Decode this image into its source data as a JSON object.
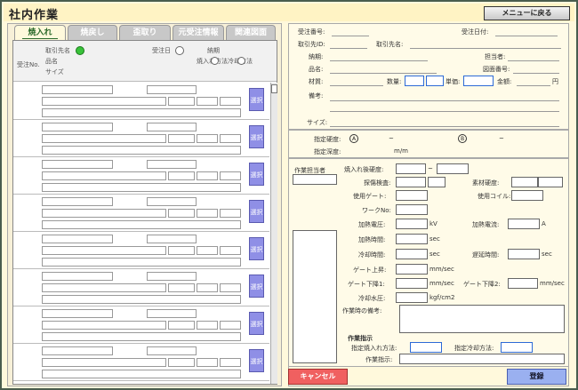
{
  "app": {
    "title": "社内作業",
    "menu_button": "メニューに戻る"
  },
  "tabs": [
    {
      "label": "焼入れ",
      "active": true
    },
    {
      "label": "焼戻し",
      "active": false
    },
    {
      "label": "歪取り",
      "active": false
    },
    {
      "label": "元受注情報",
      "active": false
    },
    {
      "label": "関連図面",
      "active": false
    }
  ],
  "grid": {
    "col_order_no": "受注No.",
    "col_client": "取引先名",
    "col_item": "品名",
    "col_size": "サイズ",
    "col_order_date": "受注日",
    "col_due": "納期",
    "col_quench_cool": "焼入れ方法冷却方法",
    "row_button": "選択",
    "rows": [
      {
        "no": "",
        "client": ""
      },
      {
        "no": "",
        "client": ""
      },
      {
        "no": "",
        "client": ""
      },
      {
        "no": "",
        "client": ""
      },
      {
        "no": "",
        "client": ""
      },
      {
        "no": "",
        "client": ""
      },
      {
        "no": "",
        "client": ""
      },
      {
        "no": "",
        "client": ""
      }
    ]
  },
  "detail": {
    "order_no": "受注番号:",
    "order_date": "受注日付:",
    "client_id": "取引先ID:",
    "client_name": "取引先名:",
    "due": "納期:",
    "person_in_charge": "担当者:",
    "item_name": "品名:",
    "drawing_no": "図面番号:",
    "material": "材質:",
    "quantity": "数量:",
    "unit_price": "単価:",
    "amount": "金額:",
    "yen": "円",
    "remarks": "備考:",
    "size": "サイズ:",
    "hardness": "指定硬度:",
    "mark_a": "A",
    "mark_b": "B",
    "tilde": "~",
    "depth": "指定深度:",
    "depth_unit": "m/m"
  },
  "work": {
    "worker": "作業担当者",
    "quench_hardness": "焼入れ後硬度:",
    "tilde": "~",
    "flaw_inspection": "探傷検査:",
    "material_hardness": "素材硬度:",
    "gate": "使用ゲート:",
    "coil": "使用コイル:",
    "work_no": "ワークNo:",
    "voltage": "加熱電圧:",
    "voltage_unit": "kV",
    "current": "加熱電流:",
    "current_unit": "A",
    "heat_time": "加熱時間:",
    "heat_time_unit": "sec",
    "cool_time": "冷却時間:",
    "cool_time_unit": "sec",
    "delay_time": "遅延時間:",
    "delay_time_unit": "sec",
    "gate_up": "ゲート上昇:",
    "gate_up_unit": "mm/sec",
    "gate_down1": "ゲート下降1:",
    "gate_down1_unit": "mm/sec",
    "gate_down2": "ゲート下降2:",
    "gate_down2_unit": "mm/sec",
    "cool_pressure": "冷却水圧:",
    "cool_pressure_unit": "kgf/cm2",
    "work_remarks": "作業時の備考:",
    "instruction_header": "作業指示",
    "spec_quench": "指定焼入れ方法:",
    "spec_cool": "指定冷却方法:",
    "instruction": "作業指示:"
  },
  "buttons": {
    "cancel": "キャンセル",
    "register": "登録"
  }
}
